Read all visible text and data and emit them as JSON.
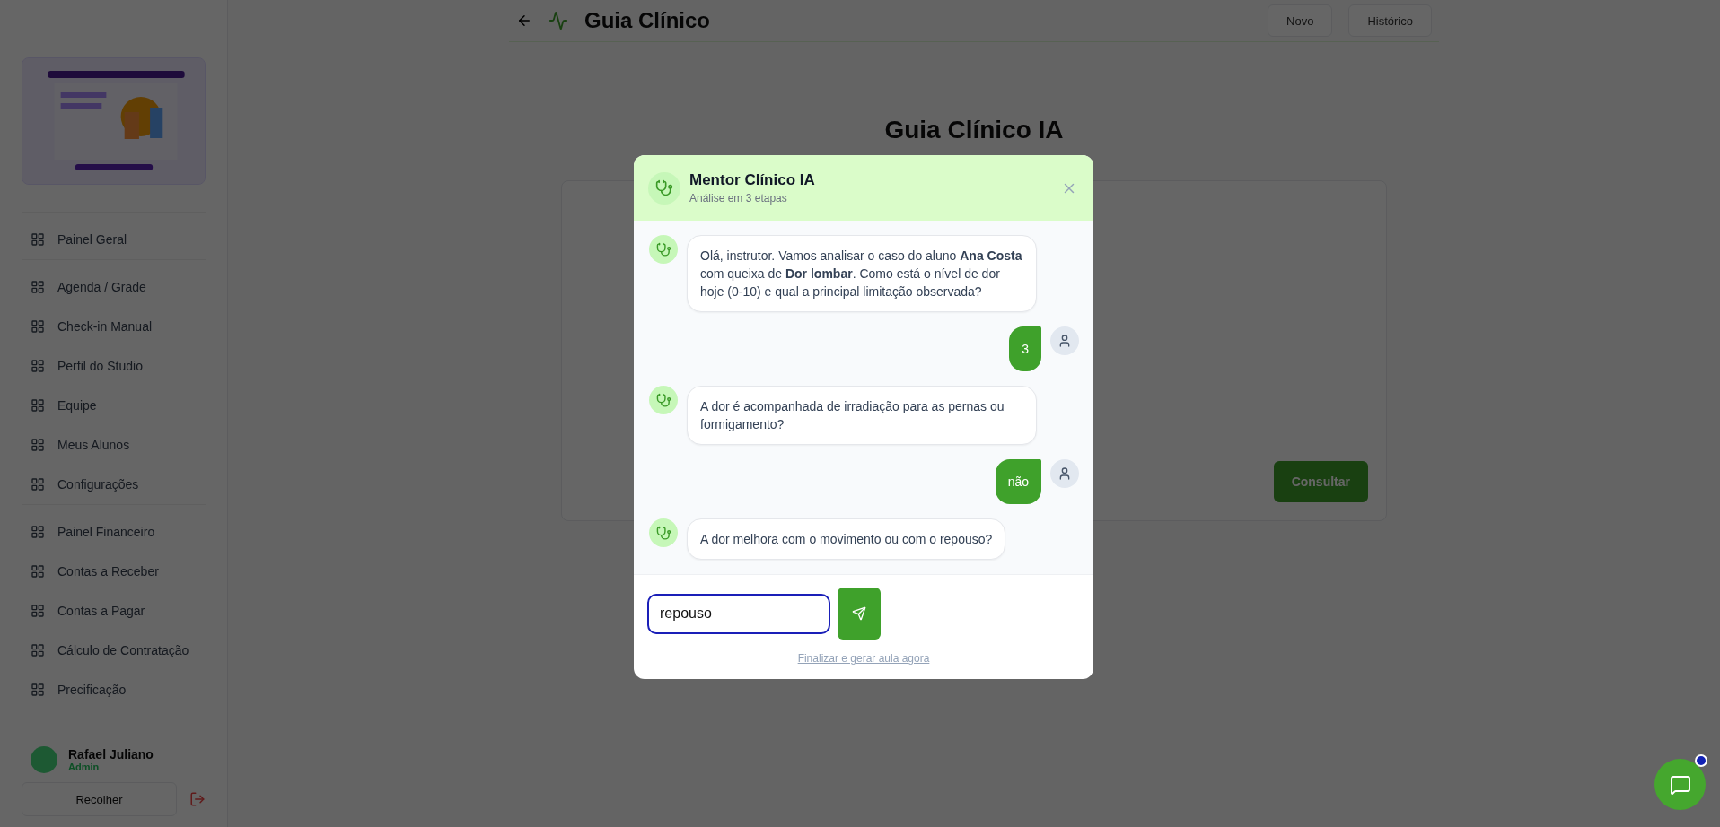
{
  "sidebar": {
    "groups": [
      {
        "items": [
          "Painel Geral"
        ]
      },
      {
        "items": [
          "Agenda / Grade",
          "Check-in Manual",
          "Perfil do Studio",
          "Equipe",
          "Meus Alunos",
          "Configurações"
        ]
      },
      {
        "items": [
          "Painel Financeiro",
          "Contas a Receber",
          "Contas a Pagar",
          "Cálculo de Contratação",
          "Precificação"
        ]
      }
    ],
    "user": {
      "name": "Rafael Juliano",
      "role": "Admin"
    },
    "collapse_button": "Recolher"
  },
  "topbar": {
    "title": "Guia Clínico",
    "buttons": [
      "Novo",
      "Histórico"
    ]
  },
  "page": {
    "title": "Guia Clínico IA",
    "submit": "Consultar"
  },
  "dialog": {
    "title": "Mentor Clínico IA",
    "subtitle": "Análise em 3 etapas",
    "messages": [
      {
        "kind": "bot",
        "text": "Olá, instrutor. Vamos analisar o caso do aluno **Ana Costa** com queixa de **Dor lombar**. Como está o nível de dor hoje (0-10) e qual a principal limitação observada?"
      },
      {
        "kind": "user",
        "text": "3"
      },
      {
        "kind": "bot",
        "text": "A dor é acompanhada de irradiação para as pernas ou formigamento?"
      },
      {
        "kind": "user",
        "text": "não"
      },
      {
        "kind": "bot",
        "text": "A dor melhora com o movimento ou com o repouso?"
      }
    ],
    "input": {
      "value": "repouso"
    },
    "finish_link": "Finalizar e gerar aula agora"
  },
  "chat_button": {
    "notification": true
  }
}
